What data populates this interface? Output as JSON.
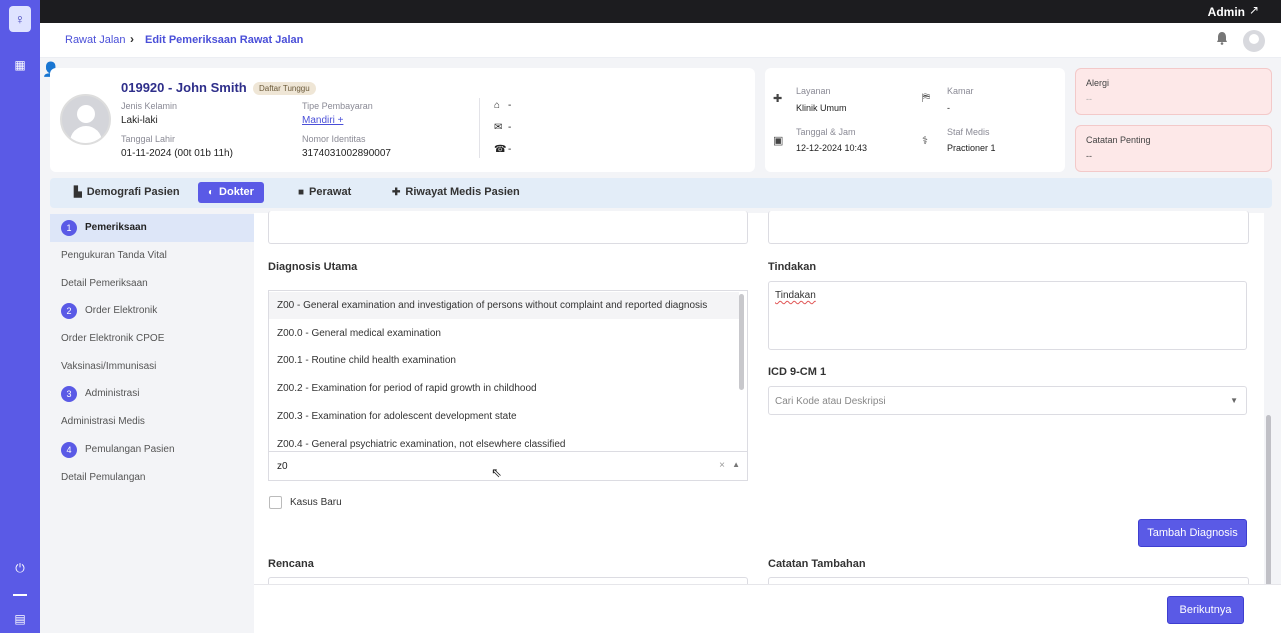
{
  "topbar": {
    "user": "Admin",
    "external_icon": "external-link-icon"
  },
  "rail": {
    "icons": [
      "logo",
      "grid-icon",
      "power-icon",
      "document-icon"
    ]
  },
  "breadcrumb": {
    "parent": "Rawat Jalan",
    "current": "Edit Pemeriksaan Rawat Jalan"
  },
  "patient": {
    "name": "019920 - John Smith",
    "status": "Daftar Tunggu",
    "gender_label": "Jenis Kelamin",
    "gender": "Laki-laki",
    "dob_label": "Tanggal Lahir",
    "dob": "01-11-2024 (00t 01b 11h)",
    "payment_label": "Tipe Pembayaran",
    "payment": "Mandiri +",
    "id_label": "Nomor Identitas",
    "id_number": "3174031002890007",
    "address": "-",
    "email": "-",
    "phone": "-"
  },
  "service": {
    "layanan_label": "Layanan",
    "layanan": "Klinik Umum",
    "datetime_label": "Tanggal & Jam",
    "datetime": "12-12-2024 10:43",
    "kamar_label": "Kamar",
    "kamar": "-",
    "staff_label": "Staf Medis",
    "staff": "Practioner 1"
  },
  "alerts": {
    "alergi_label": "Alergi",
    "alergi": "--",
    "catatan_label": "Catatan Penting",
    "catatan": "--"
  },
  "tabs": [
    {
      "label": "Demografi Pasien",
      "icon": "building-icon"
    },
    {
      "label": "Dokter",
      "icon": "stethoscope-icon",
      "active": true
    },
    {
      "label": "Perawat",
      "icon": "lock-icon"
    },
    {
      "label": "Riwayat Medis Pasien",
      "icon": "plus-icon"
    }
  ],
  "sidebar": {
    "items": [
      {
        "num": "1",
        "label": "Pemeriksaan"
      },
      {
        "label": "Pengukuran Tanda Vital"
      },
      {
        "label": "Detail Pemeriksaan"
      },
      {
        "num": "2",
        "label": "Order Elektronik"
      },
      {
        "label": "Order Elektronik CPOE"
      },
      {
        "label": "Vaksinasi/Immunisasi"
      },
      {
        "num": "3",
        "label": "Administrasi"
      },
      {
        "label": "Administrasi Medis"
      },
      {
        "num": "4",
        "label": "Pemulangan Pasien"
      },
      {
        "label": "Detail Pemulangan"
      }
    ]
  },
  "form": {
    "diagnosis_label": "Diagnosis Utama",
    "diagnosis_query": "z0",
    "diagnosis_options": [
      "Z00 - General examination and investigation of persons without complaint and reported diagnosis",
      "Z00.0 - General medical examination",
      "Z00.1 - Routine child health examination",
      "Z00.2 - Examination for period of rapid growth in childhood",
      "Z00.3 - Examination for adolescent development state",
      "Z00.4 - General psychiatric examination, not elsewhere classified"
    ],
    "clear_symbol": "×",
    "caret_up": "▲",
    "caret_down": "▼",
    "kasus_baru": "Kasus Baru",
    "tindakan_label": "Tindakan",
    "tindakan_value": "Tindakan",
    "icd_label": "ICD 9-CM 1",
    "icd_placeholder": "Cari Kode atau Deskripsi",
    "add_diagnosis": "Tambah Diagnosis",
    "rencana_label": "Rencana",
    "catatan_label": "Catatan Tambahan",
    "next": "Berikutnya"
  }
}
